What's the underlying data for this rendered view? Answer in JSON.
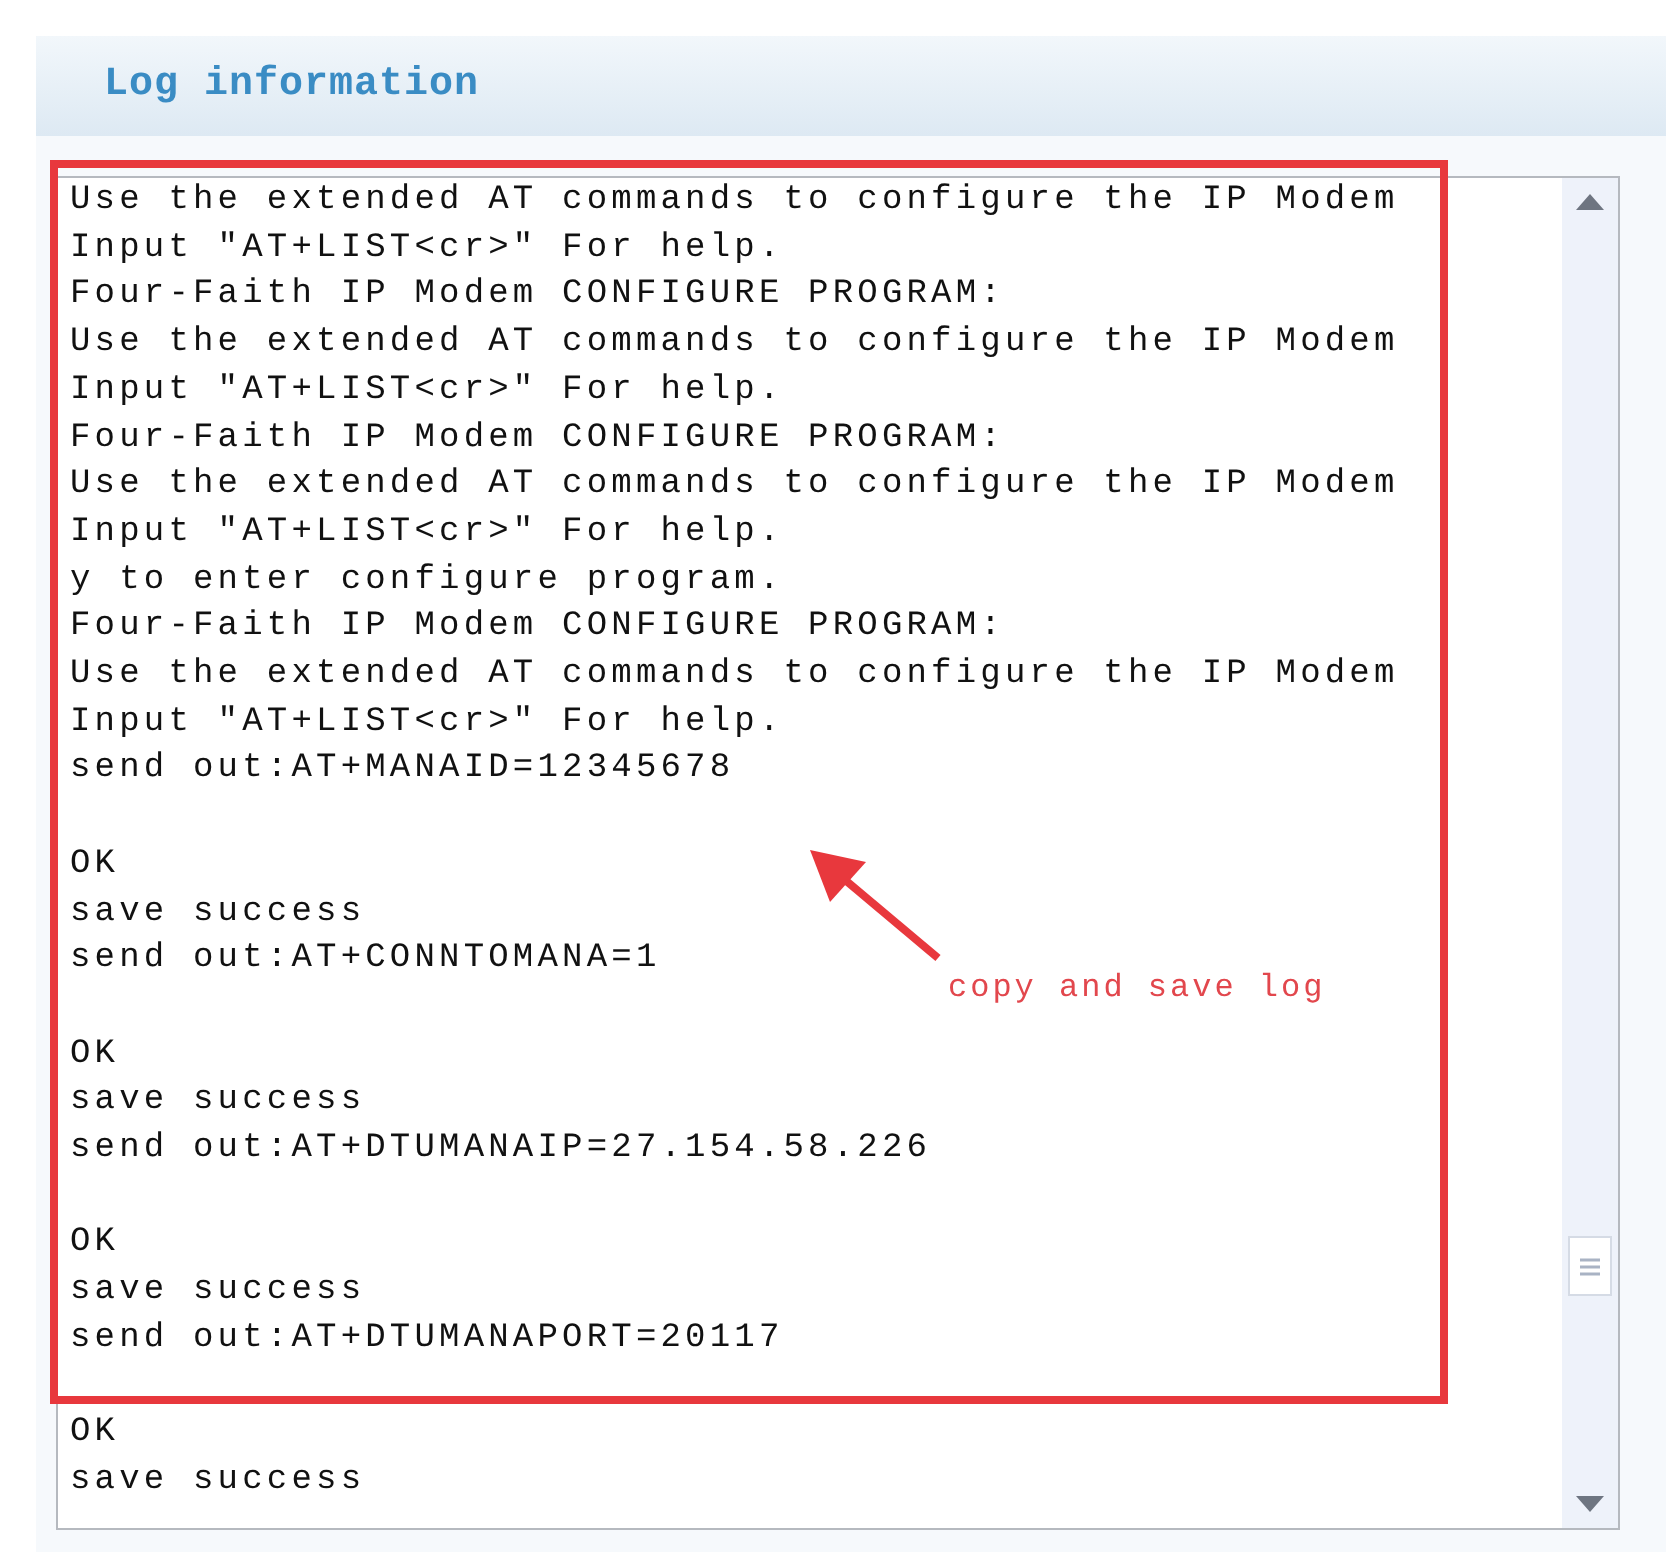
{
  "panel": {
    "title": "Log information"
  },
  "log": {
    "blocks": [
      [
        "Use the extended AT commands to configure the IP Modem",
        "Input \"AT+LIST<cr>\" For help.",
        "Four-Faith IP Modem CONFIGURE PROGRAM:",
        "Use the extended AT commands to configure the IP Modem",
        "Input \"AT+LIST<cr>\" For help.",
        "Four-Faith IP Modem CONFIGURE PROGRAM:",
        "Use the extended AT commands to configure the IP Modem",
        "Input \"AT+LIST<cr>\" For help.",
        "y to enter configure program.",
        "Four-Faith IP Modem CONFIGURE PROGRAM:",
        "Use the extended AT commands to configure the IP Modem",
        "Input \"AT+LIST<cr>\" For help.",
        "send out:AT+MANAID=12345678"
      ],
      [
        "OK",
        "save success",
        "send out:AT+CONNTOMANA=1"
      ],
      [
        "OK",
        "save success",
        "send out:AT+DTUMANAIP=27.154.58.226"
      ],
      [
        "OK",
        "save success",
        "send out:AT+DTUMANAPORT=20117"
      ],
      [
        "OK",
        "save success"
      ]
    ]
  },
  "annotation": {
    "label": "copy and save log"
  }
}
